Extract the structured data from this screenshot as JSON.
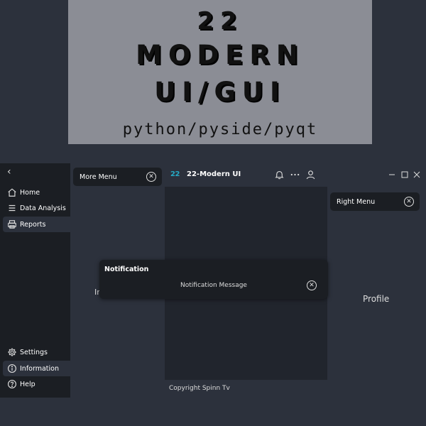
{
  "banner": {
    "line1": "22",
    "line2": "MODERN",
    "line3": "UI/GUI",
    "subtitle": "python/pyside/pyqt"
  },
  "sidebar": {
    "collapse_glyph": "‹",
    "items": [
      {
        "label": "Home",
        "icon": "home-icon"
      },
      {
        "label": "Data Analysis",
        "icon": "list-icon"
      },
      {
        "label": "Reports",
        "icon": "printer-icon",
        "active": true
      }
    ],
    "bottom_items": [
      {
        "label": "Settings",
        "icon": "gear-icon"
      },
      {
        "label": "Information",
        "icon": "info-icon",
        "active": true
      },
      {
        "label": "Help",
        "icon": "help-icon"
      }
    ]
  },
  "more_menu": {
    "title": "More Menu",
    "clipped_text": "Ir"
  },
  "titlebar": {
    "logo": "22",
    "title": "22-Modern UI",
    "icons": [
      "bell-icon",
      "more-icon",
      "user-icon",
      "minimize-icon",
      "maximize-icon",
      "close-icon"
    ]
  },
  "right_menu": {
    "title": "Right Menu",
    "profile": "Profile"
  },
  "footer": {
    "copyright": "Copyright Spinn Tv"
  },
  "notification": {
    "title": "Notification",
    "message": "Notification Message"
  },
  "colors": {
    "bg": "#2c313c",
    "sidebar": "#1b1e23",
    "content": "#21252d",
    "accent": "#26a8c3",
    "banner": "#8b8d95"
  }
}
